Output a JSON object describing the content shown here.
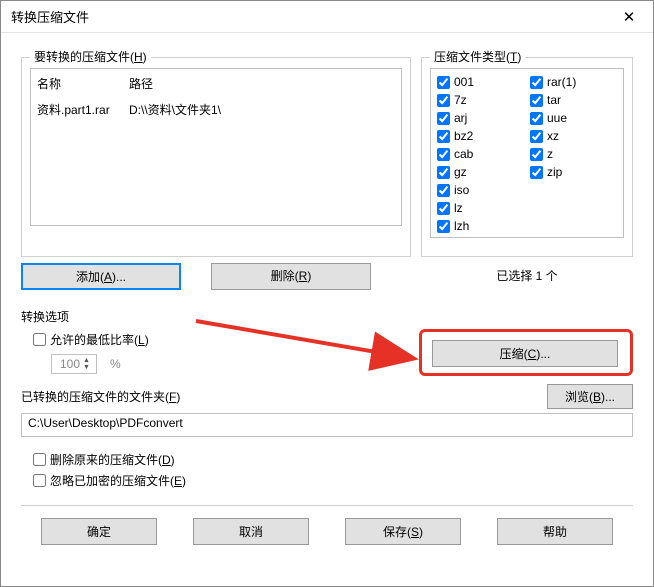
{
  "window_title": "转换压缩文件",
  "files_group": {
    "title_prefix": "要转换的压缩文件(",
    "hotkey": "H",
    "title_suffix": ")",
    "col_name": "名称",
    "col_path": "路径",
    "rows": [
      {
        "name": "资料.part1.rar",
        "path_prefix": "D:\\",
        "path_mid": "",
        "path_suffix": "\\资料\\文件夹1\\"
      }
    ],
    "add_btn_prefix": "添加(",
    "add_hotkey": "A",
    "add_btn_suffix": ")...",
    "remove_btn_prefix": "删除(",
    "remove_hotkey": "R",
    "remove_btn_suffix": ")"
  },
  "types_group": {
    "title_prefix": "压缩文件类型(",
    "hotkey": "T",
    "title_suffix": ")",
    "selected_text": "已选择 1 个",
    "items_col1": [
      "001",
      "7z",
      "arj",
      "bz2",
      "cab",
      "gz",
      "iso",
      "lz",
      "lzh"
    ],
    "items_col2": [
      "rar(1)",
      "tar",
      "uue",
      "xz",
      "z",
      "zip"
    ]
  },
  "options_label": "转换选项",
  "min_ratio": {
    "prefix": "允许的最低比率(",
    "hotkey": "L",
    "suffix": ")",
    "value": "100",
    "pct": "%"
  },
  "compress_btn": {
    "prefix": "压缩(",
    "hotkey": "C",
    "suffix": ")..."
  },
  "folder": {
    "label_prefix": "已转换的压缩文件的文件夹(",
    "hotkey": "F",
    "label_suffix": ")",
    "browse_prefix": "浏览(",
    "browse_hotkey": "B",
    "browse_suffix": ")...",
    "path_prefix": "C:\\User",
    "path_mid": "",
    "path_suffix": "\\Desktop\\PDFconvert"
  },
  "check_delete": {
    "prefix": "删除原来的压缩文件(",
    "hotkey": "D",
    "suffix": ")"
  },
  "check_skip": {
    "prefix": "忽略已加密的压缩文件(",
    "hotkey": "E",
    "suffix": ")"
  },
  "bottom": {
    "ok": "确定",
    "cancel": "取消",
    "save_prefix": "保存(",
    "save_hotkey": "S",
    "save_suffix": ")",
    "help": "帮助"
  }
}
